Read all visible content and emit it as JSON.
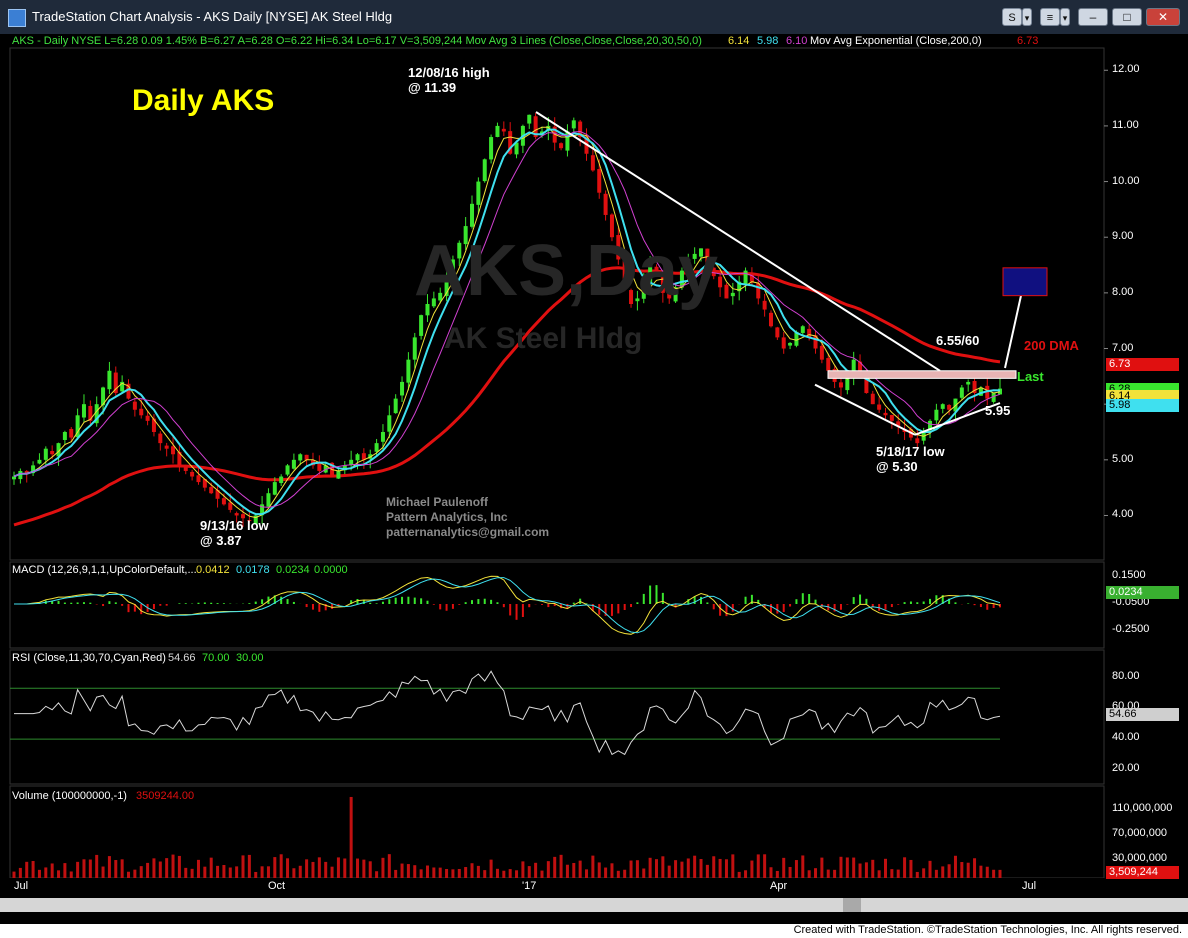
{
  "window": {
    "title": "TradeStation Chart Analysis - AKS Daily [NYSE] AK Steel Hldg",
    "btn_s": "S",
    "btn_s_menu": "▾",
    "btn_menu": "≡",
    "btn_menu_menu": "▾",
    "minimize": "–",
    "maximize": "□",
    "close": "✕"
  },
  "footer": {
    "text": "Created with TradeStation. ©TradeStation Technologies, Inc. All rights reserved."
  },
  "chart_data": {
    "type": "candlestick",
    "symbol_header": "AKS - Daily  NYSE  L=6.28  0.09  1.45%  B=6.27  A=6.28  O=6.22  Hi=6.34  Lo=6.17  V=3,509,244  Mov Avg 3 Lines (Close,Close,Close,20,30,50,0)",
    "ma_values": [
      "6.14",
      "5.98",
      "6.10"
    ],
    "ema_label": "Mov Avg Exponential (Close,200,0)",
    "ema_value": "6.73",
    "watermark": "AKS,Day",
    "watermark_sub": "AK Steel Hldg",
    "heading": "Daily AKS",
    "annotations": {
      "high": [
        "12/08/16 high",
        "@ 11.39"
      ],
      "low_sep": [
        "9/13/16 low",
        "@ 3.87"
      ],
      "low_may": [
        "5/18/17 low",
        "@ 5.30"
      ],
      "resistance": "6.55/60",
      "dma": "200 DMA",
      "last": "Last",
      "support": "5.95",
      "author": [
        "Michael Paulenoff",
        "Pattern Analytics, Inc",
        "patternanalytics@gmail.com"
      ]
    },
    "price_axis": [
      "12.00",
      "11.00",
      "10.00",
      "9.00",
      "8.00",
      "7.00",
      "6.00",
      "5.00",
      "4.00"
    ],
    "price_range": [
      3.2,
      12.4
    ],
    "price_tags": [
      {
        "value": "6.73",
        "color": "#e01010"
      },
      {
        "value": "6.28",
        "color": "#39e62e"
      },
      {
        "value": "6.14",
        "color": "#f2e23a"
      },
      {
        "value": "5.98",
        "color": "#3fe0ef"
      }
    ],
    "x_labels": [
      "Jul",
      "Oct",
      "'17",
      "Apr",
      "Jul"
    ],
    "series_closes": [
      4.7,
      4.8,
      4.75,
      4.9,
      5.0,
      5.2,
      5.1,
      5.3,
      5.5,
      5.4,
      5.8,
      6.0,
      5.7,
      6.0,
      6.3,
      6.6,
      6.2,
      6.4,
      6.1,
      5.9,
      5.8,
      5.7,
      5.5,
      5.3,
      5.2,
      5.1,
      4.9,
      4.8,
      4.7,
      4.6,
      4.5,
      4.4,
      4.3,
      4.2,
      4.1,
      4.0,
      3.95,
      3.9,
      4.0,
      4.2,
      4.4,
      4.6,
      4.7,
      4.9,
      5.0,
      5.1,
      5.0,
      4.9,
      4.8,
      4.9,
      4.7,
      4.8,
      4.9,
      5.0,
      5.1,
      5.0,
      5.1,
      5.3,
      5.5,
      5.8,
      6.1,
      6.4,
      6.8,
      7.2,
      7.6,
      7.8,
      7.9,
      8.0,
      8.3,
      8.6,
      8.9,
      9.2,
      9.6,
      10.0,
      10.4,
      10.8,
      11.0,
      10.9,
      10.5,
      10.7,
      11.0,
      11.2,
      10.8,
      10.9,
      11.0,
      10.7,
      10.6,
      10.9,
      11.1,
      10.8,
      10.5,
      10.2,
      9.8,
      9.4,
      9.0,
      8.6,
      8.1,
      7.8,
      7.9,
      8.2,
      8.5,
      8.3,
      8.0,
      7.9,
      8.1,
      8.4,
      8.6,
      8.7,
      8.8,
      8.5,
      8.3,
      8.1,
      7.9,
      8.0,
      8.2,
      8.4,
      8.2,
      7.9,
      7.7,
      7.4,
      7.2,
      7.0,
      7.1,
      7.3,
      7.4,
      7.2,
      7.0,
      6.8,
      6.6,
      6.4,
      6.3,
      6.5,
      6.8,
      6.5,
      6.2,
      6.0,
      5.9,
      5.8,
      5.7,
      5.6,
      5.5,
      5.4,
      5.3,
      5.5,
      5.7,
      5.9,
      6.0,
      5.9,
      6.1,
      6.3,
      6.4,
      6.2,
      6.3,
      6.1,
      6.2,
      6.28
    ],
    "volume_axis": [
      "110,000,000",
      "70,000,000",
      "30,000,000"
    ],
    "volume_label": "Volume (100000000,-1)",
    "volume_value": "3509244.00",
    "volume_tag": "3,509,244",
    "macd_label": "MACD (12,26,9,1,1,UpColorDefault,...",
    "macd_values": [
      "0.0412",
      "0.0178",
      "0.0234",
      "0.0000"
    ],
    "macd_axis": [
      "0.1500",
      "-0.0500",
      "-0.2500"
    ],
    "macd_tag": "0.0234",
    "rsi_label": "RSI (Close,11,30,70,Cyan,Red)",
    "rsi_values": [
      "54.66",
      "70.00",
      "30.00"
    ],
    "rsi_axis": [
      "80.00",
      "60.00",
      "40.00",
      "20.00"
    ],
    "rsi_tag": "54.66"
  }
}
